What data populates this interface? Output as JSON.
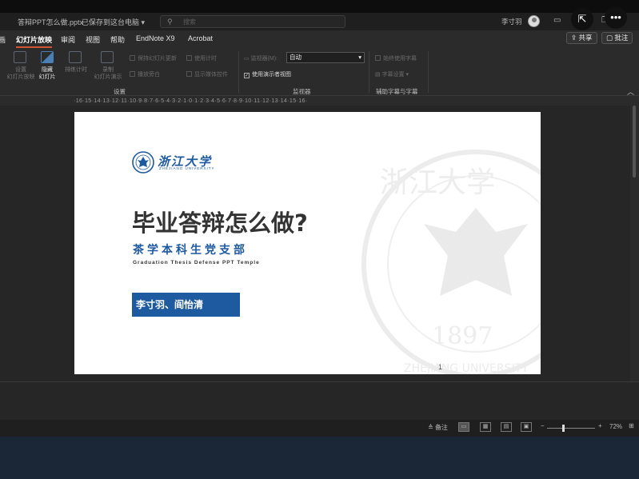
{
  "window": {
    "file_name": "答辩PPT怎么做.pptx",
    "save_status": "已保存到这台电脑",
    "search_placeholder": "搜索",
    "user_name": "李寸羽"
  },
  "ribbon_tabs": [
    "画",
    "幻灯片放映",
    "审阅",
    "视图",
    "帮助",
    "EndNote X9",
    "Acrobat"
  ],
  "actions": {
    "share": "共享",
    "comments": "批注"
  },
  "ribbon": {
    "setup_group": {
      "label": "设置",
      "setup_show": "设置\n幻灯片放映",
      "hide_slide": "隐藏\n幻灯片",
      "rehearse": "排练计时",
      "record": "录制\n幻灯片演示",
      "play_narrations": "播放旁白",
      "use_timings": "使用计时",
      "show_media_controls": "显示媒体控件",
      "keep_updated": "保持幻灯片更新"
    },
    "monitors_group": {
      "label": "监视器",
      "monitor_label": "监视器(M):",
      "monitor_value": "自动",
      "presenter_view": "使用演示者视图"
    },
    "captions_group": {
      "label": "辅助字幕与字幕",
      "always_use_subtitles": "始终使用字幕",
      "subtitle_settings": "字幕设置"
    }
  },
  "ruler_text": "·16·15·14·13·12·11·10·9·8·7·6·5·4·3·2·1·0·1·2·3·4·5·6·7·8·9·10·11·12·13·14·15·16·",
  "slide": {
    "logo_text": "浙江大学",
    "logo_sub": "ZHEJIANG UNIVERSITY",
    "title": "毕业答辩怎么做?",
    "subtitle": "茶学本科生党支部",
    "english": "Graduation Thesis Defense PPT Temple",
    "authors": "李寸羽、阎怡清",
    "number": "1",
    "watermark_year": "1897",
    "watermark_name": "ZHEJIANG UNIVERSITY"
  },
  "statusbar": {
    "notes": "备注",
    "zoom": "72%"
  },
  "colors": {
    "brand_blue": "#1e5aa0",
    "accent": "#d35230"
  }
}
